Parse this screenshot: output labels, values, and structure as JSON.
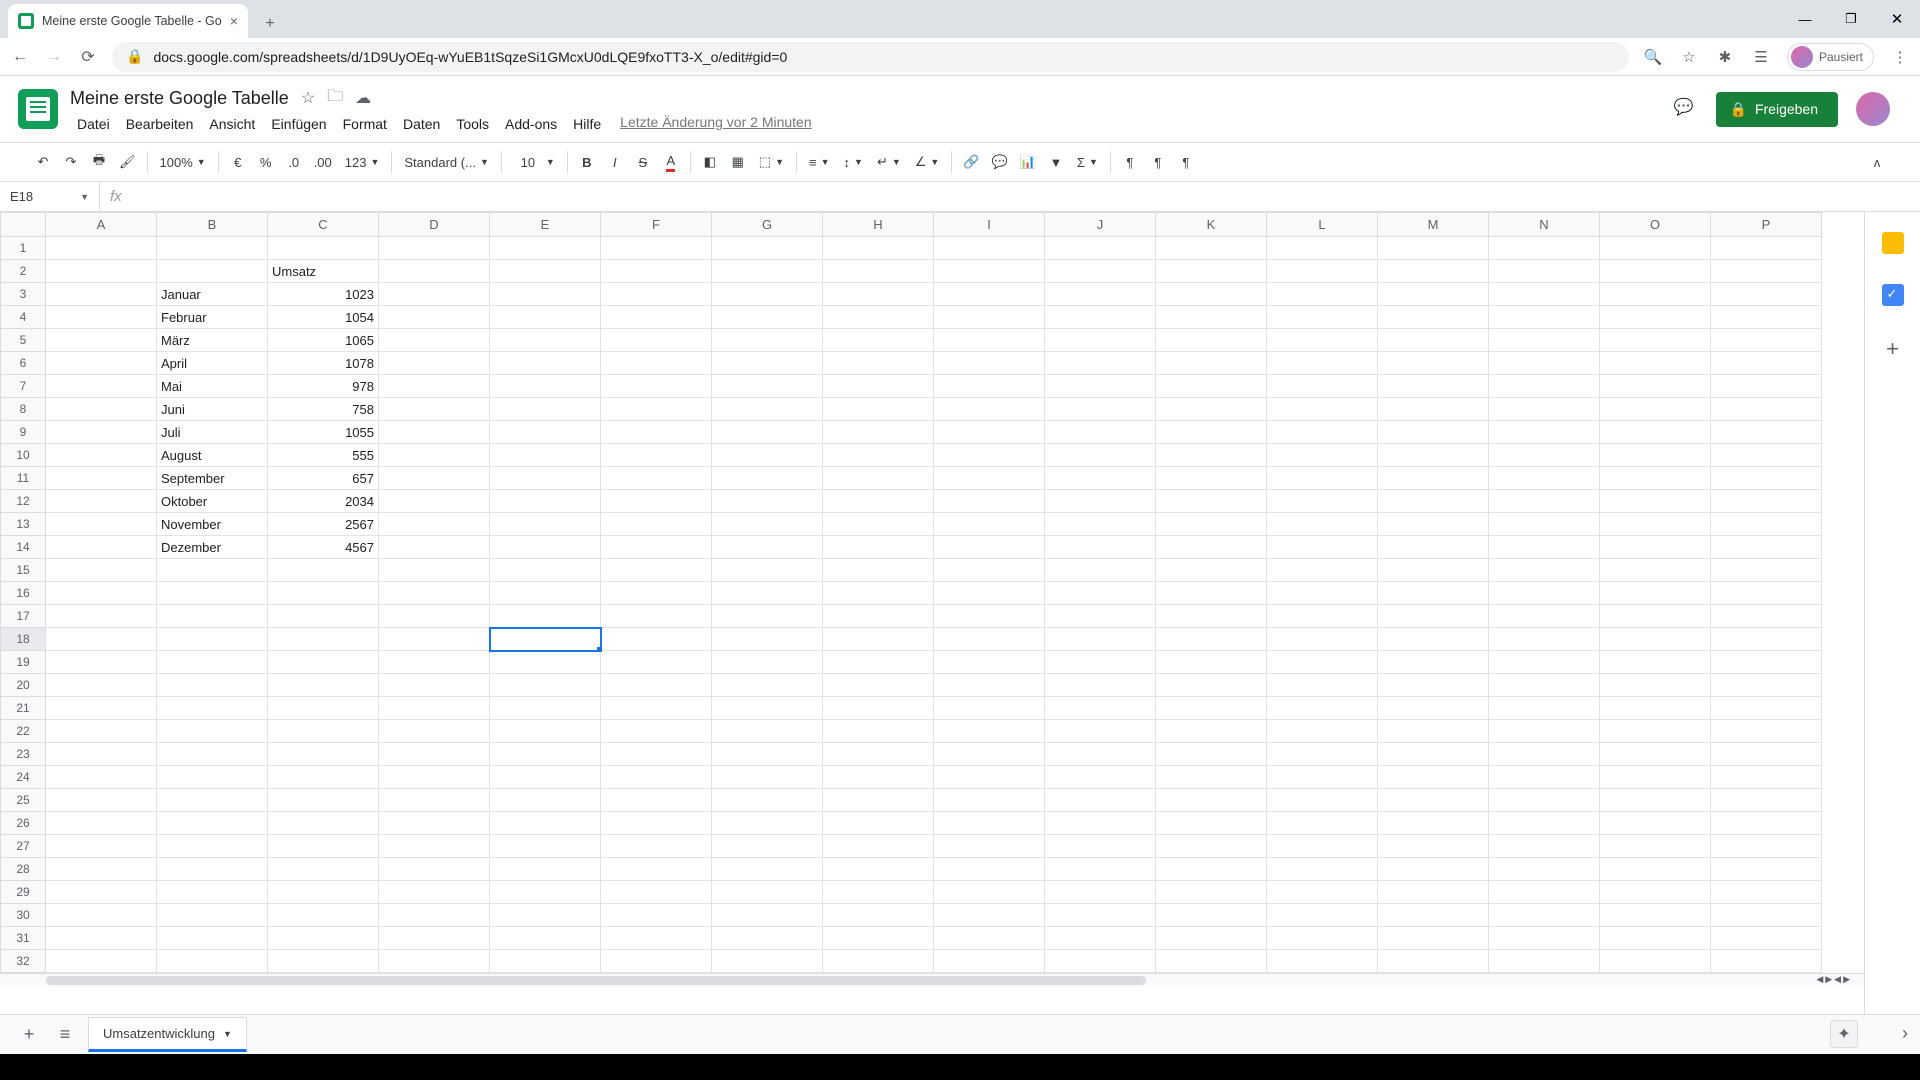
{
  "browser": {
    "tab_title": "Meine erste Google Tabelle - Go",
    "url": "docs.google.com/spreadsheets/d/1D9UyOEq-wYuEB1tSqzeSi1GMcxU0dLQE9fxoTT3-X_o/edit#gid=0",
    "profile_label": "Pausiert"
  },
  "doc": {
    "title": "Meine erste Google Tabelle",
    "last_edit": "Letzte Änderung vor 2 Minuten",
    "share_label": "Freigeben"
  },
  "menus": [
    "Datei",
    "Bearbeiten",
    "Ansicht",
    "Einfügen",
    "Format",
    "Daten",
    "Tools",
    "Add-ons",
    "Hilfe"
  ],
  "toolbar": {
    "zoom": "100%",
    "currency": "€",
    "font": "Standard (...",
    "size": "10",
    "fmt_num": "123"
  },
  "namebox": "E18",
  "columns": [
    "A",
    "B",
    "C",
    "D",
    "E",
    "F",
    "G",
    "H",
    "I",
    "J",
    "K",
    "L",
    "M",
    "N",
    "O",
    "P"
  ],
  "row_count": 32,
  "selected": {
    "col": "E",
    "row": 18
  },
  "cells": {
    "C2": "Umsatz",
    "B3": "Januar",
    "C3": "1023",
    "B4": "Februar",
    "C4": "1054",
    "B5": "März",
    "C5": "1065",
    "B6": "April",
    "C6": "1078",
    "B7": "Mai",
    "C7": "978",
    "B8": "Juni",
    "C8": "758",
    "B9": "Juli",
    "C9": "1055",
    "B10": "August",
    "C10": "555",
    "B11": "September",
    "C11": "657",
    "B12": "Oktober",
    "C12": "2034",
    "B13": "November",
    "C13": "2567",
    "B14": "Dezember",
    "C14": "4567"
  },
  "sheet_tab": "Umsatzentwicklung"
}
